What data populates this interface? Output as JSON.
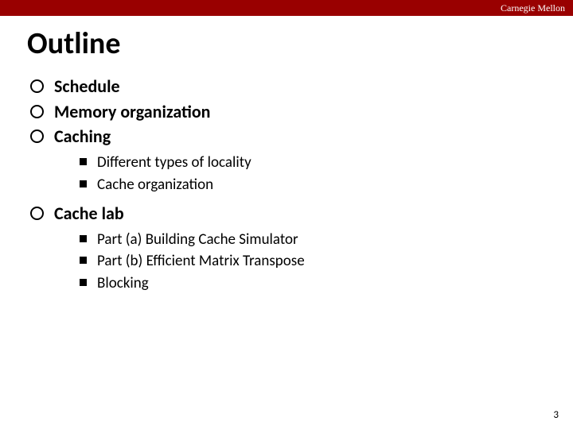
{
  "banner": "Carnegie Mellon",
  "title": "Outline",
  "items": [
    {
      "label": "Schedule"
    },
    {
      "label": "Memory organization"
    },
    {
      "label": "Caching",
      "sub": [
        "Different types of locality",
        "Cache organization"
      ]
    },
    {
      "label": "Cache lab",
      "sub": [
        "Part (a) Building Cache Simulator",
        "Part (b) Efficient Matrix Transpose",
        "Blocking"
      ]
    }
  ],
  "page_number": "3"
}
